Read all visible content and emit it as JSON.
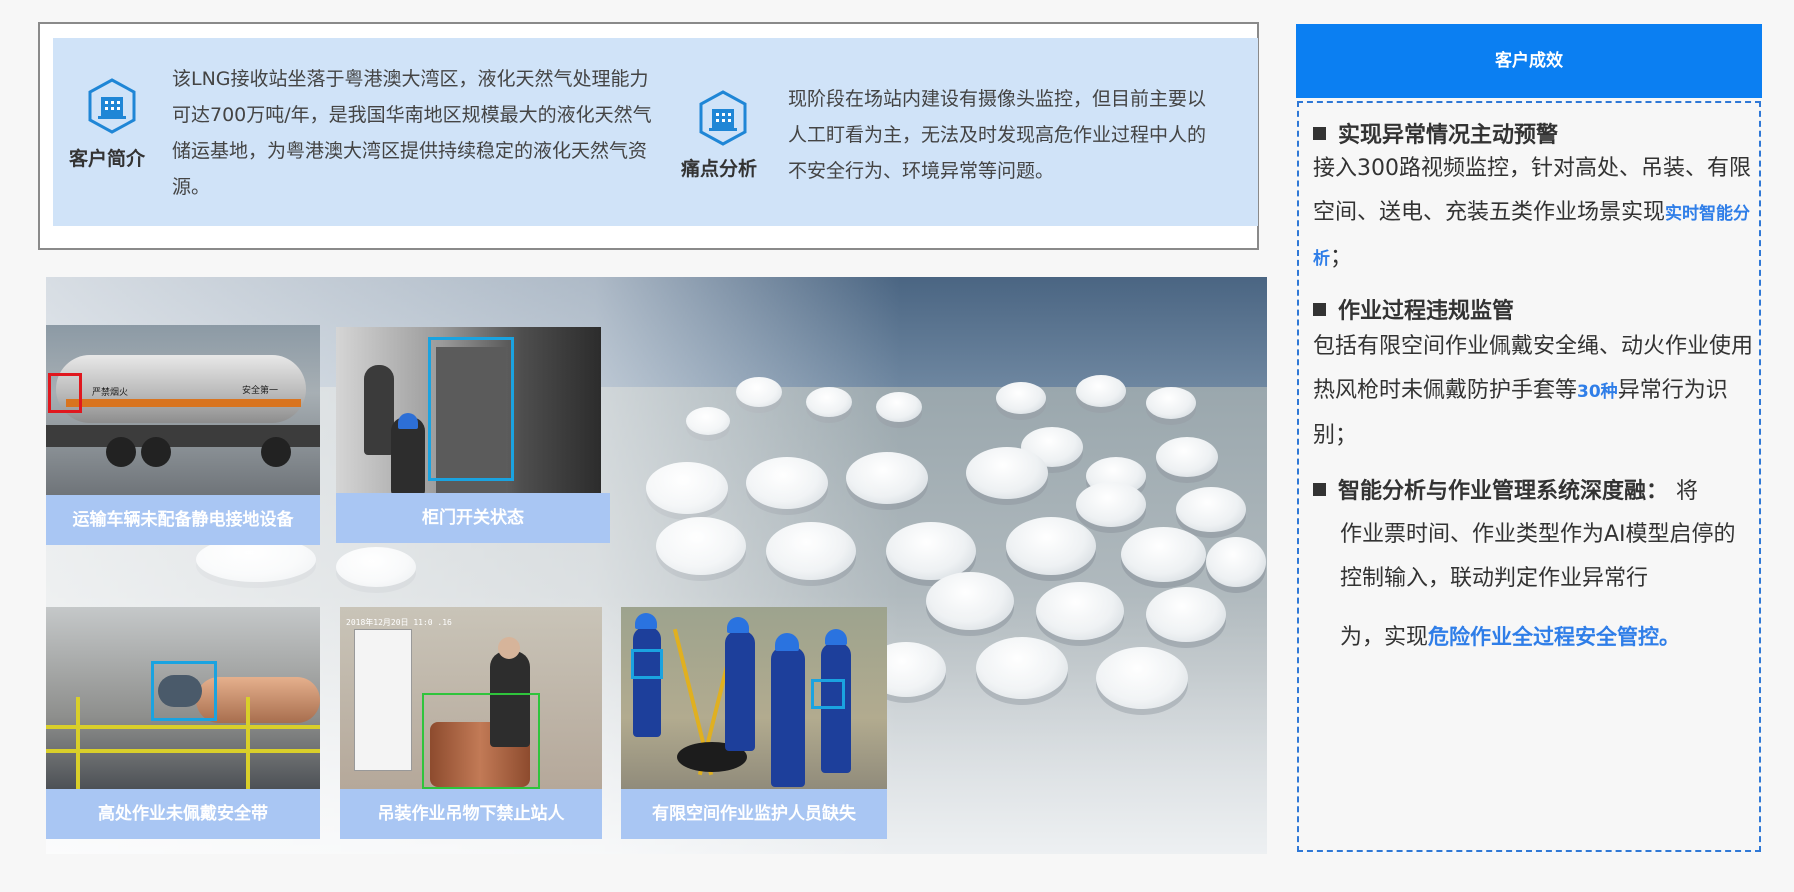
{
  "intro": {
    "label": "客户简介",
    "text": "  该LNG接收站坐落于粤港澳大湾区，液化天然气处理能力可达700万吨/年，是我国华南地区规模最大的液化天然气储运基地，为粤港澳大湾区提供持续稳定的液化天然气资源。",
    "icon": "building-icon"
  },
  "pain": {
    "label": "痛点分析",
    "text": "现阶段在场站内建设有摄像头监控，但目前主要以人工盯看为主，无法及时发现高危作业过程中人的不安全行为、环境异常等问题。",
    "icon": "building-icon"
  },
  "scenes": [
    {
      "caption": "运输车辆未配备静电接地设备",
      "sign1": "严禁烟火",
      "sign2": "安全第一"
    },
    {
      "caption": "柜门开关状态"
    },
    {
      "caption": "高处作业未佩戴安全带"
    },
    {
      "caption": "吊装作业吊物下禁止站人",
      "stamp": "2018年12月20日 11:0 .16"
    },
    {
      "caption": "有限空间作业监护人员缺失"
    }
  ],
  "results": {
    "header": "客户成效",
    "h1": "实现异常情况主动预警",
    "p1_main": "接入300路视频监控，针对高处、吊装、有限空间、送电、充装五类作业场景实现",
    "p1_hl": "实时智能分析",
    "p1_end": "；",
    "h2": "作业过程违规监管",
    "p2_main": "包括有限空间作业佩戴安全绳、动火作业使用热风枪时未佩戴防护手套等",
    "p2_hl": "30种",
    "p2_end": "异常行为识别；",
    "h3": "智能分析与作业管理系统深度融：",
    "p3_a": "将",
    "p3_main": "作业票时间、作业类型作为AI模型启停的控制输入，联动判定作业异常行",
    "p3_b": "为，实现",
    "p3_hl": "危险作业全过程安全管控。"
  },
  "colors": {
    "accent": "#0b7ff2",
    "caption_bg": "#a9c6f3",
    "info_bg": "#d0e3f8",
    "detect_box": "#1aa3e0"
  }
}
